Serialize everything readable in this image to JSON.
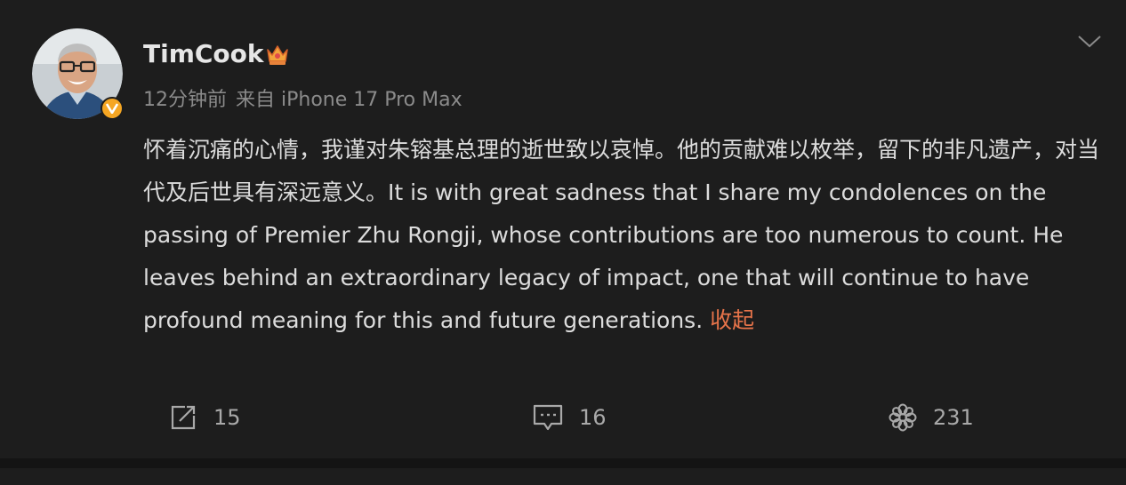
{
  "post": {
    "username": "TimCook",
    "time": "12分钟前",
    "source": "来自 iPhone 17 Pro Max",
    "text": "怀着沉痛的心情，我谨对朱镕基总理的逝世致以哀悼。他的贡献难以枚举，留下的非凡遗产，对当代及后世具有深远意义。It is with great sadness that I share my condolences on the passing of Premier Zhu Rongji, whose contributions are too numerous to count. He leaves behind an extraordinary legacy of impact, one that will continue to have profound meaning for this and future generations. ",
    "collapse_label": "收起"
  },
  "actions": {
    "repost_count": "15",
    "comment_count": "16",
    "like_count": "231"
  },
  "icons": {
    "avatar": "avatar-photo",
    "verified": "verified-badge-icon",
    "crown": "crown-icon",
    "menu": "chevron-down-icon",
    "repost": "share-icon",
    "comment": "comment-icon",
    "like": "flower-like-icon"
  },
  "colors": {
    "background": "#1d1d1d",
    "accent": "#e8744a",
    "verified": "#f5a623"
  }
}
